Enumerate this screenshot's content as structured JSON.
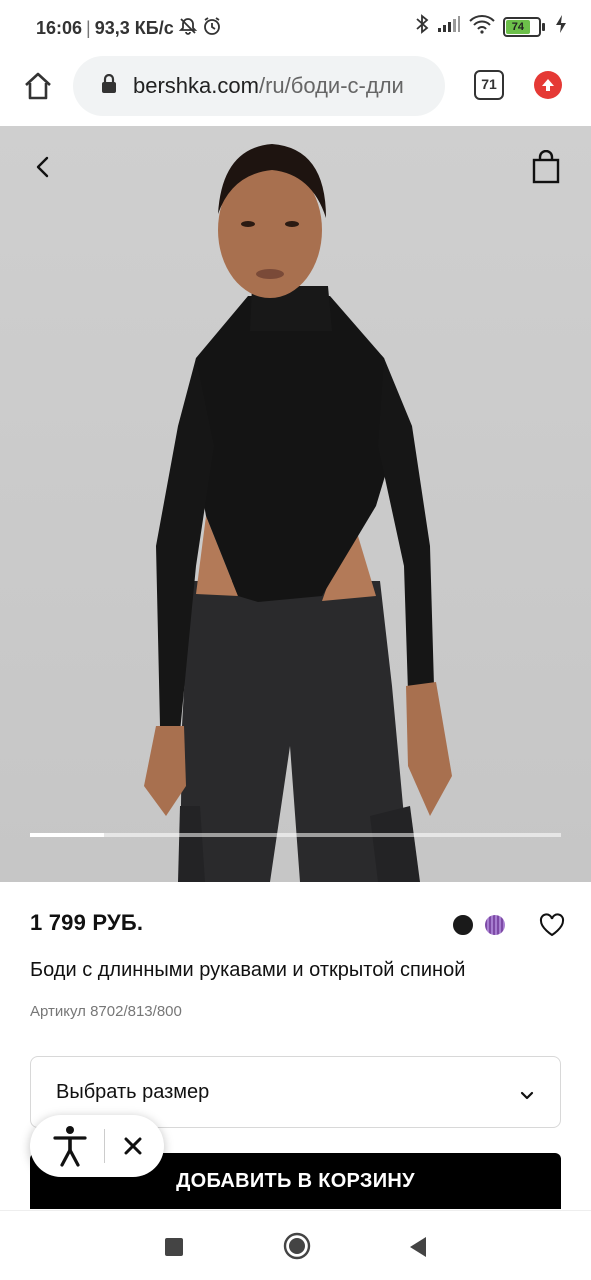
{
  "status_bar": {
    "time": "16:06",
    "separator": "|",
    "network_speed": "93,3 КБ/с",
    "battery_level": "74",
    "icons": [
      "bell-off-icon",
      "alarm-icon",
      "bluetooth-icon",
      "signal-icon",
      "wifi-icon",
      "battery-icon",
      "charging-icon"
    ]
  },
  "browser": {
    "url_host": "bershka.com",
    "url_path": "/ru/боди-с-дли",
    "tab_count": "71",
    "icons": [
      "home-icon",
      "lock-icon",
      "update-arrow-icon"
    ]
  },
  "gallery": {
    "progress": 0.14,
    "icons": [
      "chevron-left-icon",
      "shopping-bag-icon"
    ]
  },
  "product": {
    "price": "1 799 РУБ.",
    "title": "Боди с длинными рукавами и открытой спиной",
    "sku": "Артикул 8702/813/800",
    "colors": [
      {
        "name": "black",
        "hex": "#1a1a1a"
      },
      {
        "name": "purple",
        "hex": "#8a5bb8"
      }
    ]
  },
  "size_selector": {
    "label": "Выбрать размер"
  },
  "add_to_cart": {
    "label": "ДОБАВИТЬ В КОРЗИНУ"
  },
  "accessibility_widget": {
    "icons": [
      "accessibility-person-icon",
      "close-icon"
    ]
  },
  "nav_bar": {
    "icons": [
      "recent-apps-icon",
      "home-circle-icon",
      "back-triangle-icon"
    ]
  },
  "colors": {
    "accent_red": "#e53935",
    "cta_black": "#000000",
    "image_bg": "#c9c9c9"
  }
}
